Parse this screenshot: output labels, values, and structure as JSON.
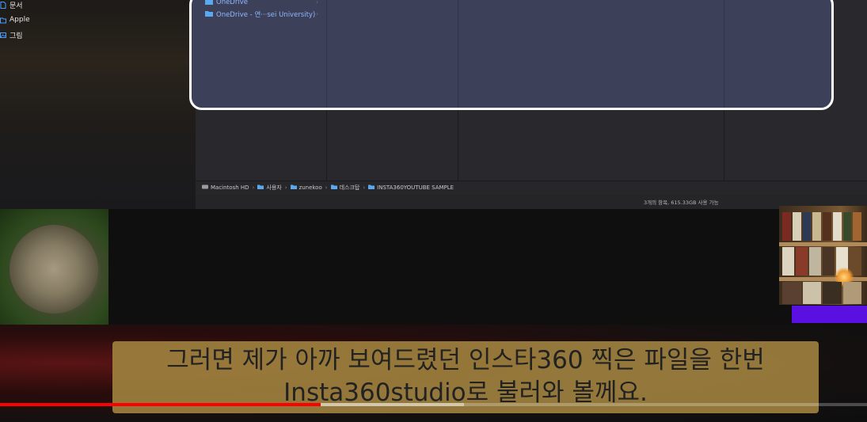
{
  "sidebar": {
    "items": [
      {
        "label": "문서",
        "icon": "document-icon"
      },
      {
        "label": "Apple",
        "icon": "folder-icon"
      },
      {
        "label": "그림",
        "icon": "photos-icon"
      }
    ]
  },
  "browser": {
    "onedrive_items": [
      {
        "label": "OneDrive",
        "icon": "folder-icon"
      },
      {
        "label": "OneDrive - 연···sei University)",
        "icon": "folder-icon"
      }
    ],
    "highlight_color": "#ffffff"
  },
  "pathbar": {
    "crumbs": [
      {
        "label": "Macintosh HD",
        "icon": "drive-icon"
      },
      {
        "label": "사용자",
        "icon": "folder-icon"
      },
      {
        "label": "zunekoo",
        "icon": "home-icon"
      },
      {
        "label": "데스크탑",
        "icon": "folder-icon"
      },
      {
        "label": "INSTA360YOUTUBE SAMPLE",
        "icon": "folder-icon"
      }
    ]
  },
  "statusbar": {
    "text": "3개의 항목, 615.33GB 사용 가능"
  },
  "caption": {
    "line1": "그러면 제가 아까 보여드렸던 인스타360 찍은 파일을 한번",
    "line2": "Insta360studio로 불러와 볼께요."
  },
  "player": {
    "progress": 0.37,
    "buffered": 0.535,
    "progress_color": "#ff0000"
  }
}
